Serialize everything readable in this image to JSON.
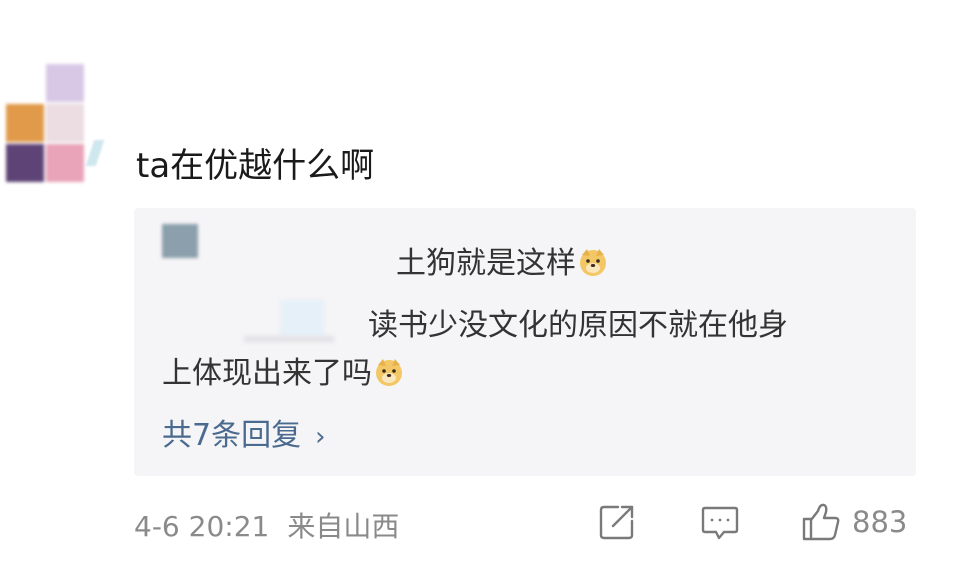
{
  "comment": {
    "text": "ta在优越什么啊"
  },
  "reply_preview": {
    "line1": "土狗就是这样",
    "line2": "读书少没文化的原因不就在他身",
    "line3": "上体现出来了吗",
    "emoji": "doge-icon",
    "more_replies": "共7条回复",
    "more_chevron": "›"
  },
  "footer": {
    "date": "4-6 20:21",
    "location": "来自山西",
    "like_count": "883",
    "icons": [
      "share-icon",
      "comment-icon",
      "thumbs-up-icon"
    ]
  },
  "colors": {
    "link": "#4a6b8f",
    "meta": "#8a8a8a",
    "reply_bg": "#f5f4f6"
  }
}
